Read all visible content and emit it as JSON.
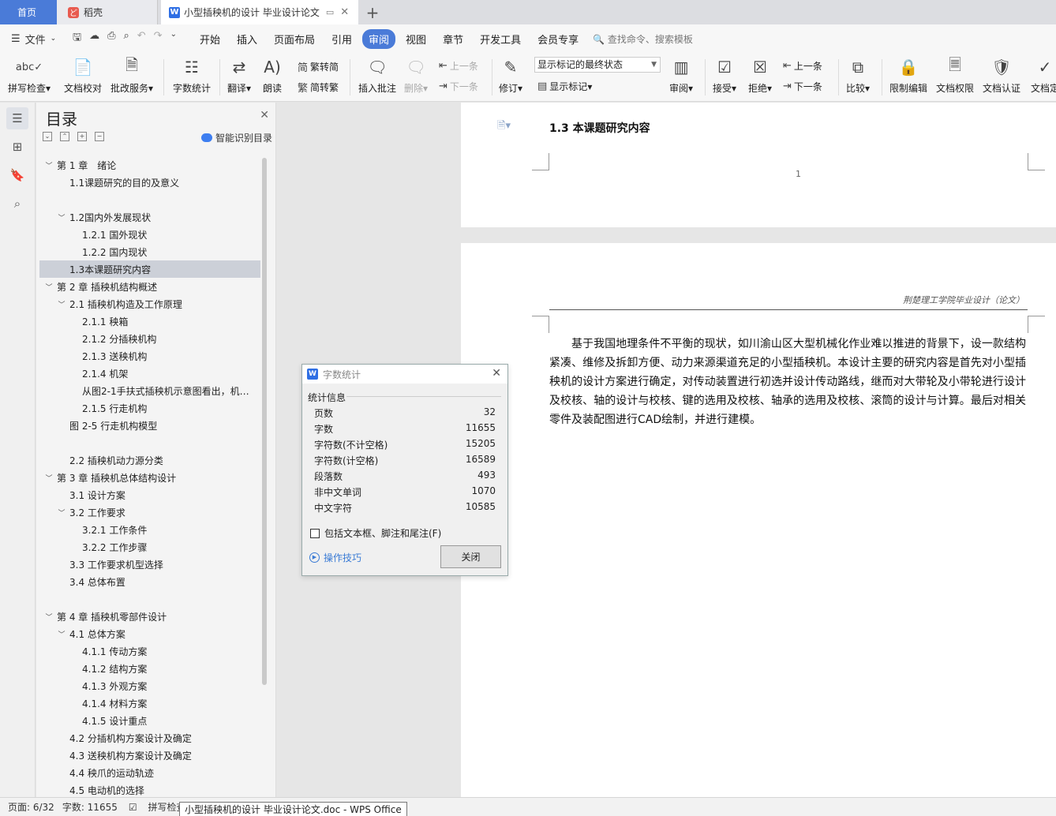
{
  "tabs": {
    "home": "首页",
    "daoke": "稻壳",
    "doc": "小型插秧机的设计 毕业设计论文"
  },
  "menu": {
    "file": "文件",
    "items": [
      "开始",
      "插入",
      "页面布局",
      "引用",
      "审阅",
      "视图",
      "章节",
      "开发工具",
      "会员专享"
    ],
    "active": "审阅",
    "search": "查找命令、搜索模板"
  },
  "ribbon": {
    "spell": "拼写检查",
    "proof": "文档校对",
    "batch": "批改服务",
    "wordcount": "字数统计",
    "translate": "翻译",
    "read": "朗读",
    "t2s": "繁转简",
    "s2t": "简转繁",
    "insert_comment": "插入批注",
    "delete": "删除",
    "prev_comment": "上一条",
    "next_comment": "下一条",
    "revise": "修订",
    "markup_state": "显示标记的最终状态",
    "show_markup": "显示标记",
    "review": "审阅",
    "accept": "接受",
    "reject": "拒绝",
    "prev": "上一条",
    "next": "下一条",
    "compare": "比较",
    "restrict": "限制编辑",
    "rights": "文档权限",
    "cert": "文档认证",
    "final": "文档定"
  },
  "toc": {
    "title": "目录",
    "smart": "智能识别目录",
    "items": [
      {
        "text": "第 1 章　绪论",
        "level": 1,
        "chev": "v"
      },
      {
        "text": "1.1课题研究的目的及意义",
        "level": 2,
        "chev": ""
      },
      {
        "text": "1.2国内外发展现状",
        "level": 2,
        "chev": "v"
      },
      {
        "text": "1.2.1  国外现状",
        "level": 3,
        "chev": ""
      },
      {
        "text": "1.2.2  国内现状",
        "level": 3,
        "chev": ""
      },
      {
        "text": "1.3本课题研究内容",
        "level": 2,
        "chev": "",
        "selected": true
      },
      {
        "text": "第 2 章  插秧机结构概述",
        "level": 1,
        "chev": "v"
      },
      {
        "text": "2.1  插秧机构造及工作原理",
        "level": 2,
        "chev": "v"
      },
      {
        "text": "2.1.1  秧箱",
        "level": 3,
        "chev": ""
      },
      {
        "text": "2.1.2  分插秧机构",
        "level": 3,
        "chev": ""
      },
      {
        "text": "2.1.3  送秧机构",
        "level": 3,
        "chev": ""
      },
      {
        "text": "2.1.4  机架",
        "level": 3,
        "chev": ""
      },
      {
        "text": "从图2-1手扶式插秧机示意图看出，机…",
        "level": 3,
        "chev": ""
      },
      {
        "text": "2.1.5  行走机构",
        "level": 3,
        "chev": ""
      },
      {
        "text": "图 2-5  行走机构模型",
        "level": 2,
        "chev": ""
      },
      {
        "text": "2.2  插秧机动力源分类",
        "level": 2,
        "chev": ""
      },
      {
        "text": "第 3 章  插秧机总体结构设计",
        "level": 1,
        "chev": "v"
      },
      {
        "text": "3.1  设计方案",
        "level": 2,
        "chev": ""
      },
      {
        "text": "3.2  工作要求",
        "level": 2,
        "chev": "v"
      },
      {
        "text": "3.2.1  工作条件",
        "level": 3,
        "chev": ""
      },
      {
        "text": "3.2.2  工作步骤",
        "level": 3,
        "chev": ""
      },
      {
        "text": "3.3  工作要求机型选择",
        "level": 2,
        "chev": ""
      },
      {
        "text": "3.4  总体布置",
        "level": 2,
        "chev": ""
      },
      {
        "text": "第 4 章  插秧机零部件设计",
        "level": 1,
        "chev": "v"
      },
      {
        "text": "4.1  总体方案",
        "level": 2,
        "chev": "v"
      },
      {
        "text": "4.1.1  传动方案",
        "level": 3,
        "chev": ""
      },
      {
        "text": "4.1.2  结构方案",
        "level": 3,
        "chev": ""
      },
      {
        "text": "4.1.3  外观方案",
        "level": 3,
        "chev": ""
      },
      {
        "text": "4.1.4  材料方案",
        "level": 3,
        "chev": ""
      },
      {
        "text": "4.1.5  设计重点",
        "level": 3,
        "chev": ""
      },
      {
        "text": "4.2  分插机构方案设计及确定",
        "level": 2,
        "chev": ""
      },
      {
        "text": "4.3  送秧机构方案设计及确定",
        "level": 2,
        "chev": ""
      },
      {
        "text": "4.4  秧爪的运动轨迹",
        "level": 2,
        "chev": ""
      },
      {
        "text": "4.5  电动机的选择",
        "level": 2,
        "chev": ""
      }
    ]
  },
  "document": {
    "heading": "1.3  本课题研究内容",
    "page_number": "1",
    "header": "荆楚理工学院毕业设计（论文）",
    "paragraph": "基于我国地理条件不平衡的现状，如川渝山区大型机械化作业难以推进的背景下，设一款结构紧凑、维修及拆卸方便、动力来源渠道充足的小型插秧机。本设计主要的研究内容是首先对小型插秧机的设计方案进行确定，对传动装置进行初选并设计传动路线，继而对大带轮及小带轮进行设计及校核、轴的设计与校核、键的选用及校核、轴承的选用及校核、滚筒的设计与计算。最后对相关零件及装配图进行CAD绘制，并进行建模。"
  },
  "dialog": {
    "title": "字数统计",
    "group": "统计信息",
    "stats": [
      {
        "label": "页数",
        "value": "32"
      },
      {
        "label": "字数",
        "value": "11655"
      },
      {
        "label": "字符数(不计空格)",
        "value": "15205"
      },
      {
        "label": "字符数(计空格)",
        "value": "16589"
      },
      {
        "label": "段落数",
        "value": "493"
      },
      {
        "label": "非中文单词",
        "value": "1070"
      },
      {
        "label": "中文字符",
        "value": "10585"
      }
    ],
    "checkbox": "包括文本框、脚注和尾注(F)",
    "tips": "操作技巧",
    "close": "关闭"
  },
  "status": {
    "page": "页面: 6/32",
    "words": "字数: 11655",
    "spell": "拼写检查",
    "tooltip": "小型插秧机的设计 毕业设计论文.doc - WPS Office"
  }
}
